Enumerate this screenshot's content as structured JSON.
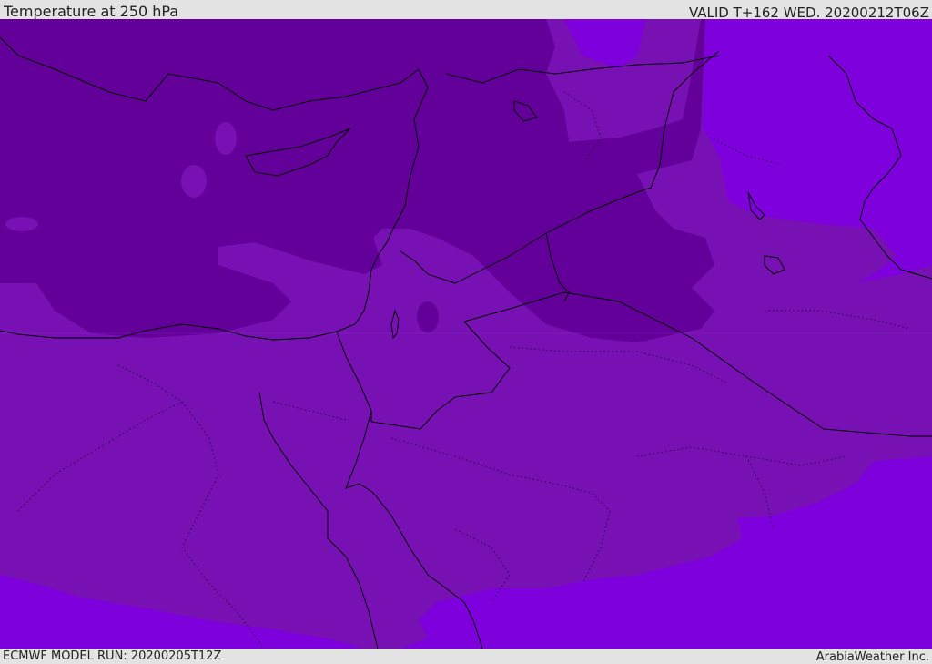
{
  "header": {
    "title": "Temperature at 250 hPa",
    "valid": "VALID T+162 WED. 20200212T06Z"
  },
  "footer": {
    "model_run": "ECMWF MODEL RUN: 20200205T12Z",
    "credit": "ArabiaWeather Inc."
  },
  "map": {
    "variable": "Temperature",
    "level": "250 hPa",
    "colors": {
      "coldest_band": "#630099",
      "mid_band": "#7711b3",
      "warm_band": "#7e00dc",
      "border_line": "#000000"
    }
  }
}
